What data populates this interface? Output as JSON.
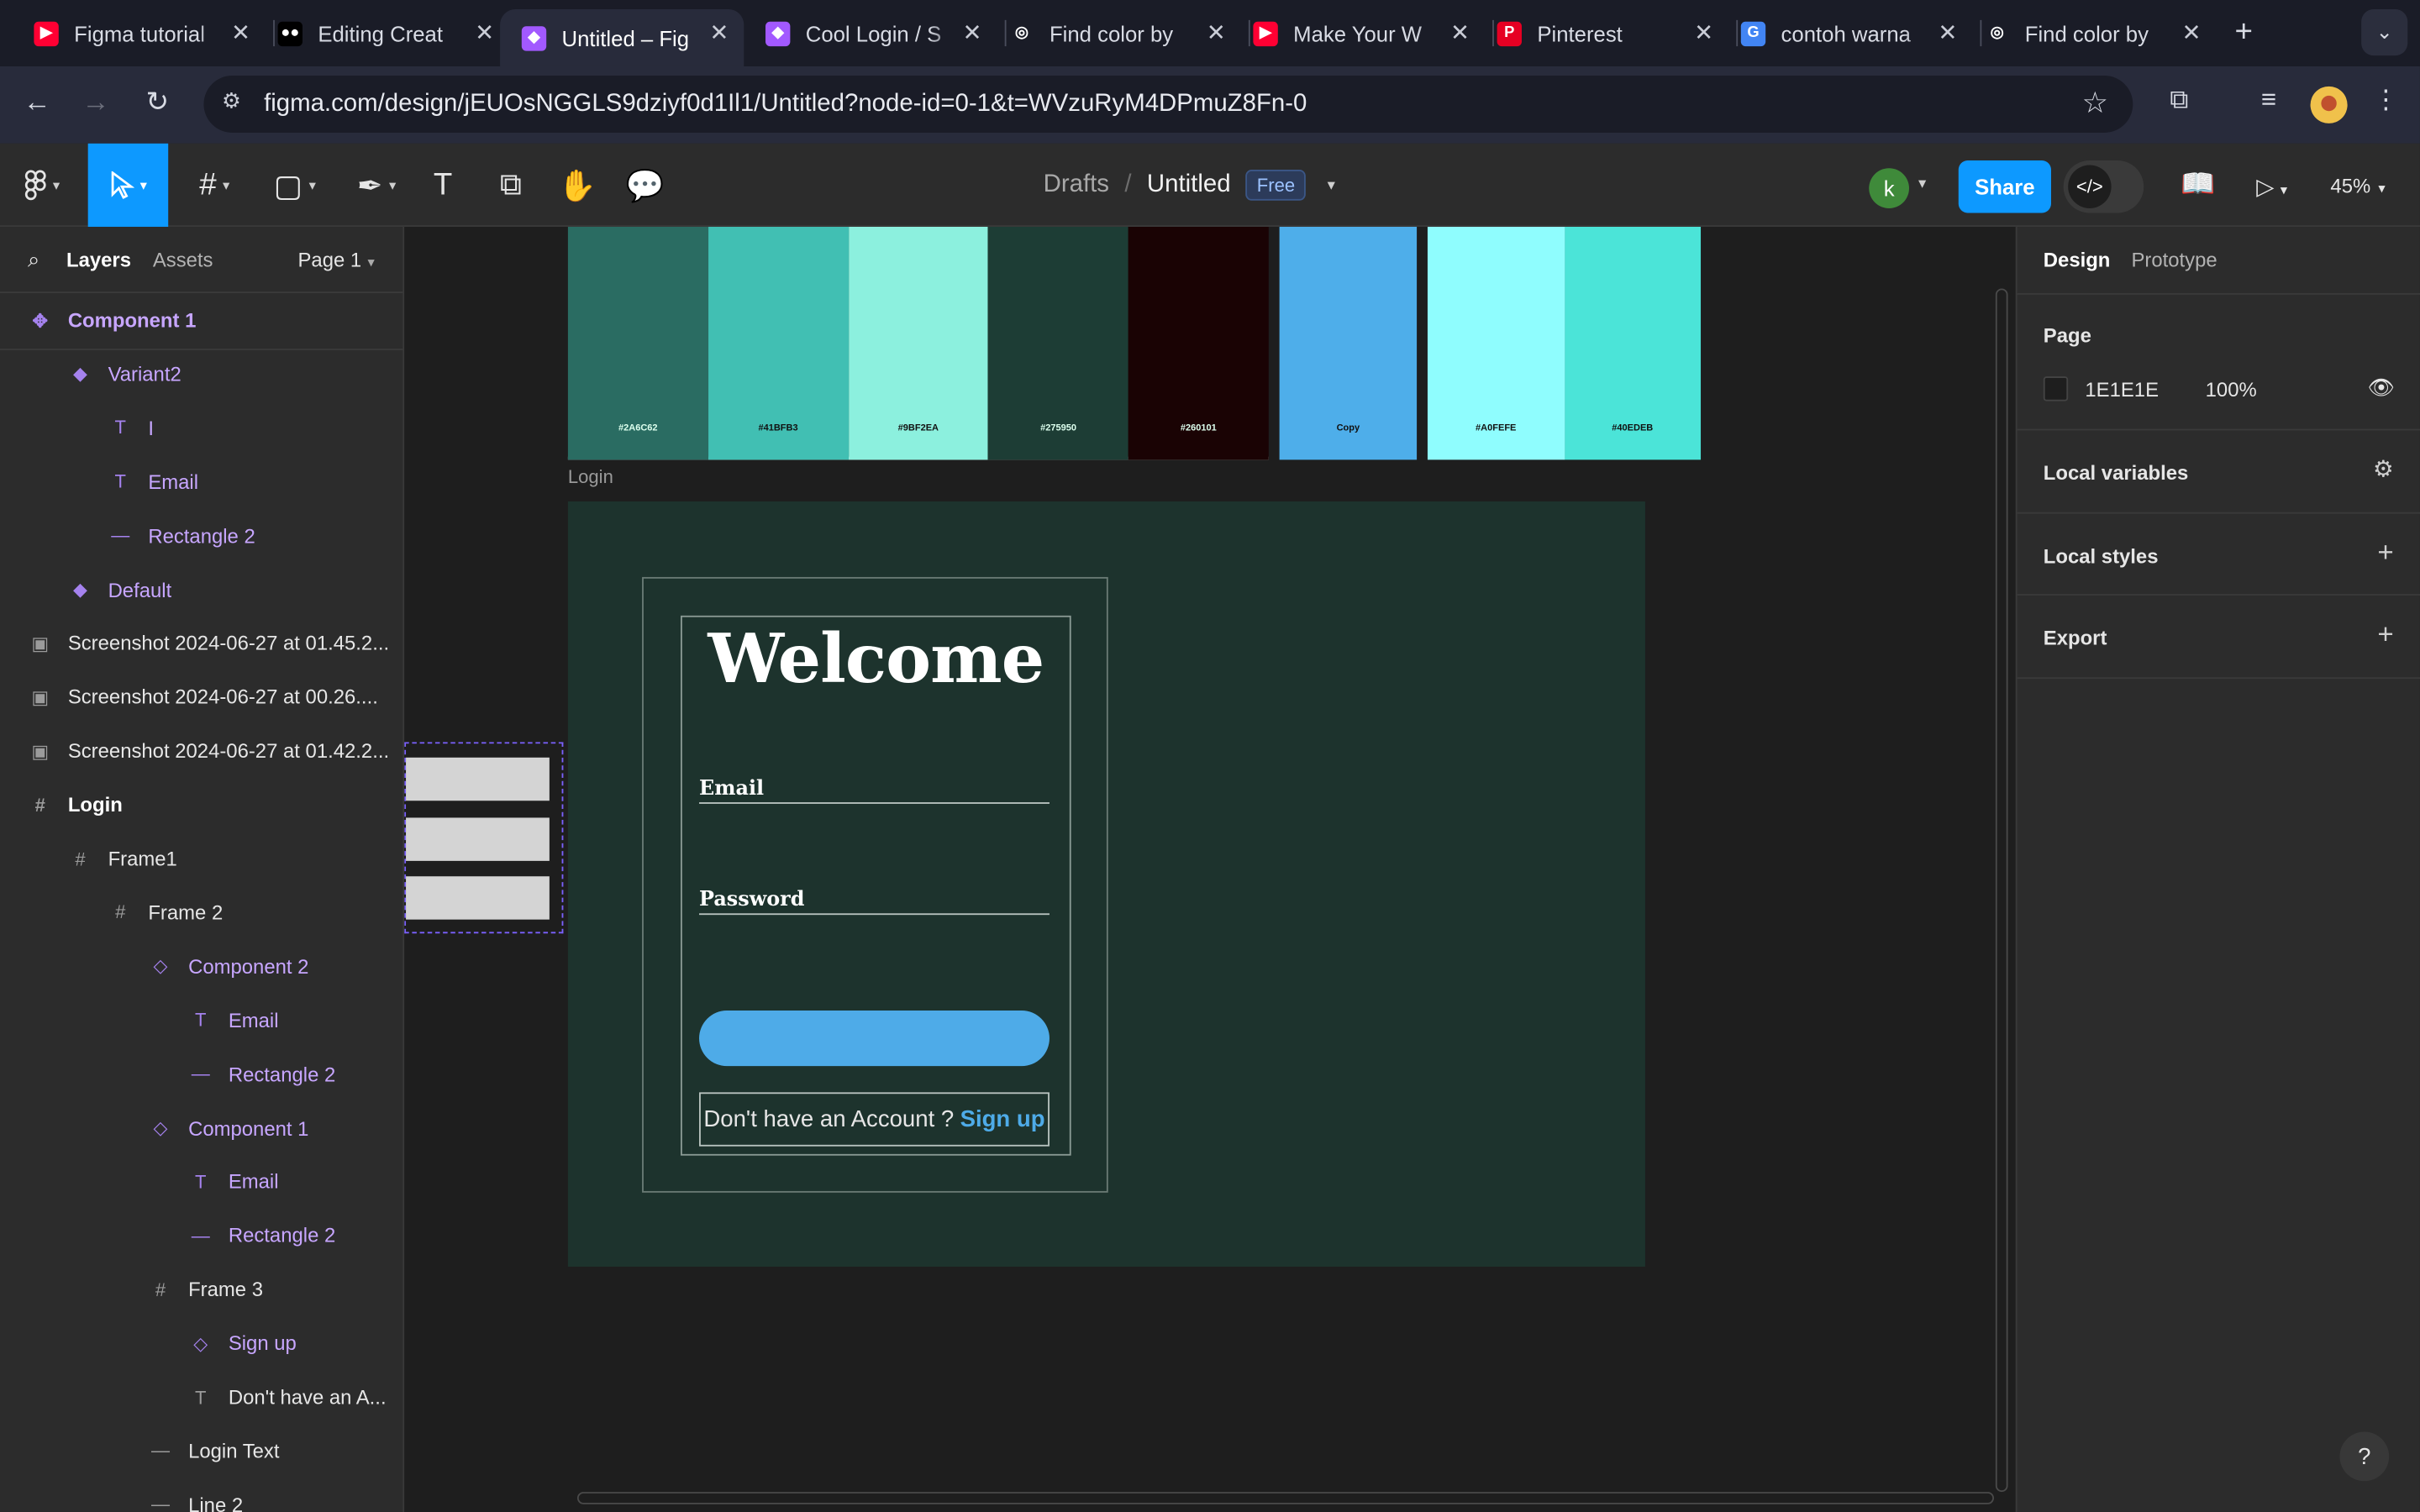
{
  "browser": {
    "tabs": [
      {
        "title": "Figma tutorial",
        "favicon": "youtube-icon",
        "color": "#ff0033"
      },
      {
        "title": "Editing Creat",
        "favicon": "medium-icon",
        "color": "#000000"
      },
      {
        "title": "Untitled – Fig",
        "favicon": "figma-icon",
        "color": "#a259ff"
      },
      {
        "title": "Cool Login / S",
        "favicon": "figma-icon",
        "color": "#a259ff"
      },
      {
        "title": "Find color by",
        "favicon": "colorhunt-icon",
        "color": "#ffffff"
      },
      {
        "title": "Make Your W",
        "favicon": "youtube-icon",
        "color": "#ff0033"
      },
      {
        "title": "Pinterest",
        "favicon": "pinterest-icon",
        "color": "#e60023"
      },
      {
        "title": "contoh warna",
        "favicon": "google-icon",
        "color": "#4285f4"
      },
      {
        "title": "Find color by",
        "favicon": "colorhunt-icon",
        "color": "#ffffff"
      }
    ],
    "active_tab": 2,
    "url": "figma.com/design/jEUOsNGGLS9dziyf0d1Il1/Untitled?node-id=0-1&t=WVzuRyM4DPmuZ8Fn-0"
  },
  "toolbar": {
    "breadcrumb_drafts": "Drafts",
    "breadcrumb_slash": "/",
    "file_name": "Untitled",
    "plan_badge": "Free",
    "avatar_initial": "k",
    "share_label": "Share",
    "zoom": "45%"
  },
  "left_panel": {
    "tab_layers": "Layers",
    "tab_assets": "Assets",
    "page_selector": "Page 1",
    "layers": [
      {
        "name": "Component 1",
        "icon": "component-set-icon",
        "indent": 0,
        "style": "comp-main"
      },
      {
        "name": "Variant2",
        "icon": "variant-icon",
        "indent": 1,
        "style": "purple"
      },
      {
        "name": "I",
        "icon": "text-icon",
        "indent": 2,
        "style": "purple"
      },
      {
        "name": "Email",
        "icon": "text-icon",
        "indent": 2,
        "style": "purple"
      },
      {
        "name": "Rectangle 2",
        "icon": "line-icon",
        "indent": 2,
        "style": "purple"
      },
      {
        "name": "Default",
        "icon": "variant-icon",
        "indent": 1,
        "style": "purple"
      },
      {
        "name": "Screenshot 2024-06-27 at 01.45.2...",
        "icon": "image-icon",
        "indent": 0,
        "style": "normal"
      },
      {
        "name": "Screenshot 2024-06-27 at 00.26....",
        "icon": "image-icon",
        "indent": 0,
        "style": "normal"
      },
      {
        "name": "Screenshot 2024-06-27 at 01.42.2...",
        "icon": "image-icon",
        "indent": 0,
        "style": "normal"
      },
      {
        "name": "Login",
        "icon": "frame-icon",
        "indent": 0,
        "style": "bold"
      },
      {
        "name": "Frame1",
        "icon": "frame-icon",
        "indent": 1,
        "style": "normal"
      },
      {
        "name": "Frame 2",
        "icon": "frame-icon",
        "indent": 2,
        "style": "normal"
      },
      {
        "name": "Component 2",
        "icon": "instance-icon",
        "indent": 3,
        "style": "purple"
      },
      {
        "name": "Email",
        "icon": "text-icon",
        "indent": 4,
        "style": "purple"
      },
      {
        "name": "Rectangle 2",
        "icon": "line-icon",
        "indent": 4,
        "style": "purple"
      },
      {
        "name": "Component 1",
        "icon": "instance-icon",
        "indent": 3,
        "style": "purple"
      },
      {
        "name": "Email",
        "icon": "text-icon",
        "indent": 4,
        "style": "purple"
      },
      {
        "name": "Rectangle 2",
        "icon": "line-icon",
        "indent": 4,
        "style": "purple"
      },
      {
        "name": "Frame 3",
        "icon": "frame-icon",
        "indent": 3,
        "style": "normal"
      },
      {
        "name": "Sign up",
        "icon": "instance-icon",
        "indent": 4,
        "style": "purple"
      },
      {
        "name": "Don't have an A...",
        "icon": "text-icon",
        "indent": 4,
        "style": "normal"
      },
      {
        "name": "Login Text",
        "icon": "line-icon",
        "indent": 3,
        "style": "normal"
      },
      {
        "name": "Line 2",
        "icon": "line-icon",
        "indent": 3,
        "style": "normal"
      }
    ]
  },
  "canvas": {
    "swatches": [
      {
        "hex": "#2A6C62",
        "label": "#2A6C62"
      },
      {
        "hex": "#41BFB3",
        "label": "#41BFB3"
      },
      {
        "hex": "#8CF0DE",
        "label": "#9BF2EA"
      },
      {
        "hex": "#1D3D35",
        "label": "#275950"
      },
      {
        "hex": "#1A0304",
        "label": "#260101"
      }
    ],
    "swatches_b": [
      {
        "hex": "#4EAEEA",
        "label": "Copy"
      },
      {
        "hex": "#8FFDFE",
        "label": "#A0FEFE"
      },
      {
        "hex": "#4BE4D8",
        "label": "#40EDEB"
      }
    ],
    "frame_label": "Login",
    "welcome": "Welcome",
    "email_label": "Email",
    "password_label": "Password",
    "signup_prompt": "Don't have an Account ?",
    "signup_link": "Sign up"
  },
  "right_panel": {
    "tab_design": "Design",
    "tab_prototype": "Prototype",
    "page_title": "Page",
    "page_color": "1E1E1E",
    "page_opacity": "100%",
    "local_variables": "Local variables",
    "local_styles": "Local styles",
    "export": "Export"
  }
}
